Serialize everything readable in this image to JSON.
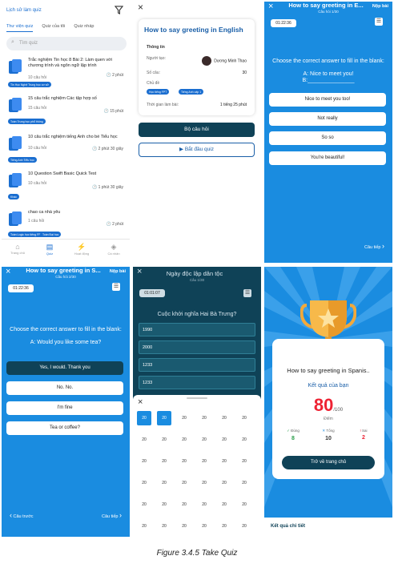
{
  "colors": {
    "accent": "#1a8ce0",
    "dark": "#0f4257",
    "brand": "#1a6ed0",
    "score": "#e23"
  },
  "library": {
    "header": "Lịch sử làm quiz",
    "tabs": [
      "Thư viện quiz",
      "Quiz của tôi",
      "Quiz nháp"
    ],
    "search_placeholder": "Tìm quiz",
    "items": [
      {
        "title": "Trắc nghiệm Tin học 8 Bài 2: Làm quen với chương trình và ngôn ngữ lập trình",
        "count": "10 câu hỏi",
        "time": "2 phút",
        "tags": [
          "Tin Học Nghệ Trung học cơ sở"
        ]
      },
      {
        "title": "15 câu trắc nghiệm Các tập hợp số",
        "count": "15 câu hỏi",
        "time": "15 phút",
        "tags": [
          "Toán Trung học phổ thông"
        ]
      },
      {
        "title": "10 câu trắc nghiệm tiếng Anh cho bé Tiểu học",
        "count": "10 câu hỏi",
        "time": "2 phút 30 giây",
        "tags": [
          "Tiếng Anh Tiểu học"
        ]
      },
      {
        "title": "10 Question Swift Basic Quick Test",
        "count": "10 câu hỏi",
        "time": "1 phút 30 giây",
        "tags": [
          "Khác"
        ]
      },
      {
        "title": "chao ca nhà yêu",
        "count": "1 câu hỏi",
        "time": "2 phút",
        "tags": [
          "Toán Logic học tiếng FPT",
          "Toán Đại học"
        ]
      }
    ],
    "nav": [
      "Trang chủ",
      "Quiz",
      "Hoạt động",
      "Cá nhân"
    ]
  },
  "detail": {
    "title": "How to say greeting in English",
    "info_label": "Thông tin",
    "creator_label": "Người tạo:",
    "creator": "Dương Minh Thao",
    "count_label": "Số câu:",
    "count": "30",
    "topic_label": "Chủ đề",
    "topics": [
      "Học tiếng FPT",
      "Tiếng Anh cấp 1"
    ],
    "time_label": "Thời gian làm bài:",
    "time": "1 tiếng 25 phút",
    "save_btn": "Bộ câu hỏi",
    "start_btn": "Bắt đầu quiz"
  },
  "q1": {
    "title": "How to say greeting in E...",
    "sub": "Câu hỏi 1/30",
    "submit": "Nộp bài",
    "timer": "01:22:36",
    "question": "Choose the correct answer to fill in the blank:",
    "line_a": "A: Nice to meet you!",
    "line_b": "B:_______________",
    "answers": [
      "Nice to meet you too!",
      "Not really",
      "So so",
      "You're beautiful!"
    ],
    "next": "Câu tiếp"
  },
  "q2": {
    "title": "How to say greeting in S...",
    "sub": "Câu hỏi 2/30",
    "submit": "Nộp bài",
    "timer": "01:22:36",
    "question": "Choose the correct answer to fill in the blank:",
    "line_a": "A: Would you like some tea?",
    "answers": [
      "Yes, I would. Thank you",
      "No. No.",
      "I'm fine",
      "Tea or coffee?"
    ],
    "prev": "Câu trước",
    "next": "Câu tiếp"
  },
  "q3": {
    "title": "Ngày độc lập dân tộc",
    "sub": "Câu 1/30",
    "timer": "01:01:07",
    "question": "Cuộc khởi nghĩa Hai Bà Trưng?",
    "options": [
      "1990",
      "2000",
      "1233",
      "1233"
    ],
    "grid": [
      "20",
      "20",
      "20",
      "20",
      "20",
      "20",
      "20",
      "20",
      "20",
      "20",
      "20",
      "20",
      "20",
      "20",
      "20",
      "20",
      "20",
      "20",
      "20",
      "20",
      "20",
      "20",
      "20",
      "20",
      "20",
      "20",
      "20",
      "20",
      "20",
      "20",
      "20",
      "20",
      "20",
      "20",
      "20",
      "20"
    ]
  },
  "result": {
    "title": "How to say greeting in Spanis..",
    "subtitle": "Kết quả của bạn",
    "score": "80",
    "max": "/100",
    "score_label": "Điểm",
    "correct_label": "Đúng",
    "correct": "8",
    "total_label": "Tổng",
    "total": "10",
    "wrong_label": "Sai",
    "wrong": "2",
    "home_btn": "Trở về trang chủ",
    "detail": "Kết quả chi tiết"
  },
  "caption": "Figure 3.4.5 Take Quiz"
}
